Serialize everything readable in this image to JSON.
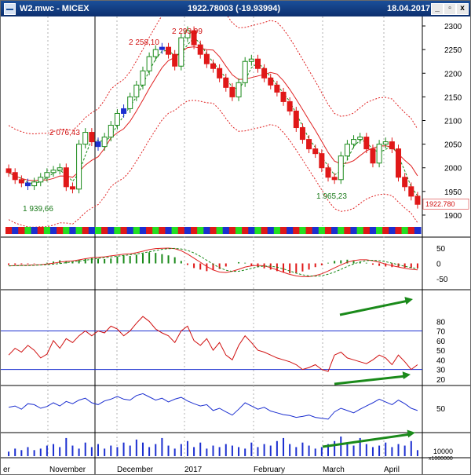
{
  "window": {
    "title": "W2.mwc - MICEX",
    "price_readout": "1922.78003 (-19.93994)",
    "date": "18.04.2017",
    "controls": {
      "minimize": "_",
      "restore": "▫",
      "close": "x"
    }
  },
  "colors": {
    "up": "#1a8a1a",
    "down": "#e01818",
    "neutral": "#1c2fd0",
    "grid": "#1c2fd0",
    "ma": "#e02020",
    "ma_fast": "#1a8a1a"
  },
  "chart_data": [
    {
      "type": "candlestick",
      "panel": "price",
      "ylim": [
        1880,
        2320
      ],
      "yticks": [
        "2300",
        "2250",
        "2200",
        "2150",
        "2100",
        "2050",
        "2000",
        "1950",
        "1900"
      ],
      "last_value_label": "1922.780",
      "close": [
        1990,
        1975,
        1968,
        1962,
        1970,
        1980,
        1990,
        1995,
        2000,
        1960,
        1955,
        2050,
        2075,
        2055,
        2045,
        2065,
        2090,
        2115,
        2125,
        2150,
        2175,
        2205,
        2235,
        2250,
        2255,
        2240,
        2215,
        2275,
        2290,
        2260,
        2240,
        2220,
        2210,
        2190,
        2170,
        2150,
        2180,
        2225,
        2230,
        2210,
        2190,
        2175,
        2160,
        2140,
        2120,
        2085,
        2060,
        2040,
        2030,
        2000,
        1980,
        1975,
        2025,
        2050,
        2060,
        2065,
        2040,
        2010,
        2050,
        2055,
        2040,
        1980,
        1960,
        1940,
        1922.78
      ],
      "direction": [
        "down",
        "down",
        "down",
        "neutral",
        "up",
        "up",
        "up",
        "up",
        "up",
        "down",
        "down",
        "up",
        "up",
        "down",
        "neutral",
        "up",
        "up",
        "up",
        "neutral",
        "up",
        "up",
        "up",
        "up",
        "up",
        "neutral",
        "down",
        "down",
        "up",
        "up",
        "down",
        "down",
        "down",
        "down",
        "down",
        "down",
        "down",
        "up",
        "up",
        "up",
        "down",
        "down",
        "down",
        "down",
        "down",
        "down",
        "down",
        "down",
        "down",
        "down",
        "down",
        "down",
        "down",
        "up",
        "up",
        "up",
        "up",
        "down",
        "down",
        "up",
        "up",
        "down",
        "down",
        "down",
        "down",
        "down"
      ],
      "annotations": [
        {
          "text": "2 258,10",
          "value": 2258.1
        },
        {
          "text": "2 293,99",
          "value": 2293.99
        },
        {
          "text": "2 076,43",
          "value": 2076.43
        },
        {
          "text": "1 939,66",
          "value": 1939.66
        },
        {
          "text": "1 965,23",
          "value": 1965.23
        }
      ],
      "overlays": [
        "moving average (red, solid)",
        "moving average (green, dashed)",
        "envelope bands (red, dotted)"
      ]
    },
    {
      "type": "bar",
      "panel": "macd",
      "yticks": [
        "50",
        "0",
        "-50"
      ],
      "ylim": [
        -80,
        80
      ],
      "histogram": [
        -5,
        -4,
        -3,
        -2,
        -1,
        0,
        2,
        6,
        10,
        8,
        5,
        12,
        16,
        18,
        15,
        14,
        16,
        22,
        26,
        24,
        28,
        32,
        36,
        34,
        30,
        26,
        20,
        8,
        -5,
        -15,
        -20,
        -25,
        -22,
        -18,
        -10,
        0,
        4,
        2,
        -8,
        -12,
        -16,
        -20,
        -25,
        -28,
        -32,
        -30,
        -26,
        -20,
        -12,
        -6,
        2,
        8,
        10,
        12,
        8,
        4,
        2,
        -4,
        -8,
        -10,
        -12,
        -12,
        -14,
        -15,
        -16
      ],
      "signal_line": "red solid",
      "average_line": "green dashed",
      "trendline": "green arrow, rising"
    },
    {
      "type": "line",
      "panel": "oscillator-1",
      "yticks": [
        "80",
        "70",
        "60",
        "50",
        "40",
        "30",
        "20"
      ],
      "ylim": [
        15,
        90
      ],
      "reference_lines": [
        70,
        30
      ],
      "values": [
        45,
        52,
        48,
        55,
        50,
        42,
        46,
        60,
        52,
        62,
        58,
        65,
        70,
        65,
        70,
        68,
        75,
        72,
        65,
        70,
        78,
        85,
        80,
        72,
        68,
        65,
        58,
        70,
        75,
        60,
        55,
        62,
        50,
        58,
        45,
        40,
        55,
        65,
        58,
        50,
        48,
        45,
        42,
        40,
        38,
        35,
        30,
        32,
        35,
        30,
        28,
        45,
        48,
        42,
        40,
        38,
        36,
        40,
        45,
        42,
        35,
        45,
        38,
        30,
        35
      ],
      "trendline": "green arrow, rising"
    },
    {
      "type": "line",
      "panel": "oscillator-2",
      "yticks": [
        "50"
      ],
      "ylim": [
        0,
        100
      ],
      "values": [
        52,
        55,
        48,
        60,
        58,
        50,
        54,
        62,
        55,
        65,
        60,
        68,
        72,
        62,
        58,
        66,
        70,
        76,
        70,
        68,
        78,
        82,
        75,
        68,
        72,
        64,
        70,
        74,
        66,
        60,
        55,
        58,
        45,
        50,
        42,
        35,
        48,
        62,
        55,
        48,
        52,
        44,
        40,
        36,
        34,
        30,
        32,
        35,
        30,
        28,
        26,
        42,
        50,
        45,
        40,
        48,
        55,
        62,
        70,
        64,
        58,
        68,
        60,
        50,
        45
      ],
      "trendline": "green arrow, rising"
    },
    {
      "type": "bar",
      "panel": "volume",
      "unit_label": "x1000000",
      "tick_label": "10000",
      "values": [
        3,
        5,
        4,
        6,
        4,
        5,
        7,
        8,
        6,
        12,
        7,
        5,
        9,
        6,
        8,
        5,
        7,
        6,
        9,
        7,
        11,
        9,
        6,
        8,
        12,
        7,
        5,
        8,
        10,
        6,
        9,
        5,
        7,
        6,
        8,
        7,
        6,
        5,
        9,
        6,
        8,
        7,
        10,
        12,
        8,
        6,
        9,
        7,
        5,
        6,
        8,
        10,
        13,
        9,
        7,
        12,
        8,
        6,
        7,
        9,
        6,
        8,
        7,
        10,
        4
      ]
    }
  ],
  "color_strip": [
    "red",
    "blue",
    "red",
    "green",
    "blue",
    "red",
    "green",
    "blue",
    "red",
    "green",
    "blue",
    "green",
    "red",
    "blue",
    "green",
    "red",
    "blue",
    "green",
    "red",
    "blue",
    "green",
    "blue",
    "red",
    "green",
    "red",
    "blue",
    "green",
    "red",
    "blue",
    "red",
    "green",
    "blue",
    "red",
    "green",
    "blue",
    "red",
    "green",
    "red",
    "blue",
    "green",
    "red",
    "blue",
    "green",
    "red",
    "blue",
    "red",
    "green",
    "red",
    "blue",
    "green",
    "red",
    "blue",
    "green",
    "red",
    "blue",
    "green",
    "red",
    "blue",
    "green",
    "red",
    "blue",
    "red",
    "green",
    "red",
    "blue"
  ],
  "x_axis_labels": [
    "er",
    "November",
    "December",
    "2017",
    "February",
    "March",
    "April"
  ]
}
